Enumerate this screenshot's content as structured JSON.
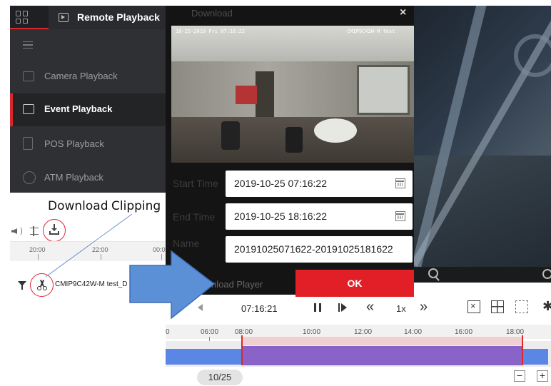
{
  "sidebar": {
    "tab_label": "Remote Playback",
    "items": [
      {
        "label": "Camera Playback",
        "icon": "camera-playback-icon"
      },
      {
        "label": "Event Playback",
        "icon": "event-playback-icon",
        "active": true
      },
      {
        "label": "POS Playback",
        "icon": "pos-icon"
      },
      {
        "label": "ATM Playback",
        "icon": "atm-icon"
      }
    ]
  },
  "annotations": {
    "download": "Download",
    "clipping": "Clipping"
  },
  "mini_timeline": {
    "ticks": [
      "20:00",
      "22:00",
      "00:0"
    ]
  },
  "camera_row": {
    "name": "CMIP9C42W-M test_D"
  },
  "modal": {
    "title": "Download",
    "close": "×",
    "overlay_left": "10-25-2019 Fri 07:16:22",
    "overlay_right": "CMIP9C42W-M test",
    "start_label": "Start Time",
    "start_value": "2019-10-25 07:16:22",
    "end_label": "End Time",
    "end_value": "2019-10-25 18:16:22",
    "name_label": "Name",
    "name_value": "20191025071622-20191025181622",
    "download_player": "Download Player",
    "ok_label": "OK"
  },
  "playback": {
    "time": "07:16:21",
    "speed": "1x",
    "rewind": "«",
    "forward": "»",
    "settings": "✱"
  },
  "timeline": {
    "labels": [
      "0",
      "06:00",
      "08:00",
      "10:00",
      "12:00",
      "14:00",
      "16:00",
      "18:00"
    ],
    "date": "10/25",
    "minus": "−",
    "plus": "+"
  },
  "colors": {
    "accent_red": "#e21f26",
    "clip_purple": "#8a63c8",
    "timeline_blue": "#5a86e6",
    "arrow_blue": "#5b8fd6"
  }
}
